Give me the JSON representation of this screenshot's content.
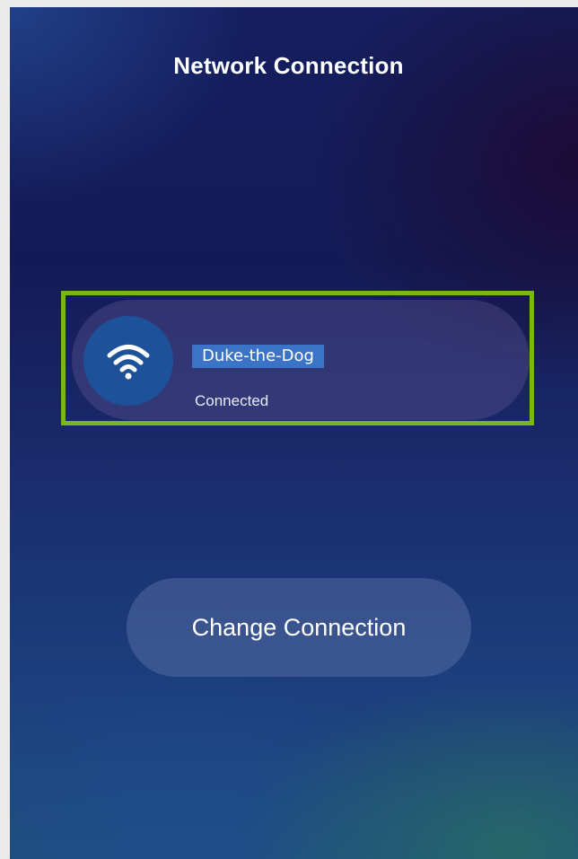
{
  "screen": {
    "title": "Network Connection"
  },
  "network": {
    "ssid": "Duke-the-Dog",
    "status": "Connected",
    "icon": "wifi-icon"
  },
  "actions": {
    "change_connection_label": "Change Connection"
  },
  "colors": {
    "highlight_border": "#7ab617",
    "wifi_circle": "#1d5199",
    "ssid_selection": "#3b73c6"
  }
}
